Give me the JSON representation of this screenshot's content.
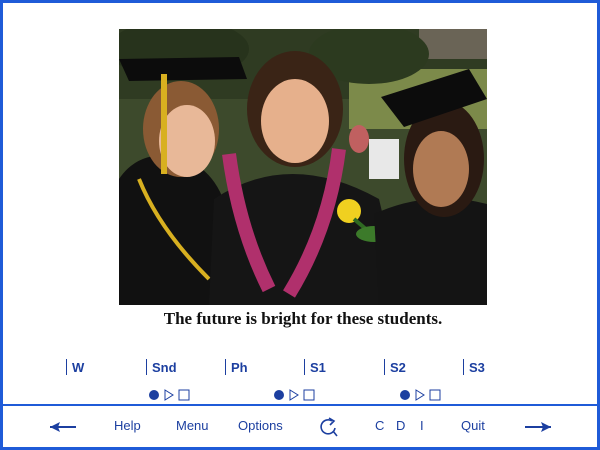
{
  "photo": {
    "alt": "Three graduates in caps and gowns with leis and a yellow rose"
  },
  "caption": "The future is bright for these students.",
  "tool_labels": [
    "W",
    "Snd",
    "Ph",
    "S1",
    "S2",
    "S3"
  ],
  "media_controls": [
    {
      "state": "record",
      "icons": [
        "circle-icon",
        "play-icon",
        "stop-icon"
      ]
    },
    {
      "state": "record",
      "icons": [
        "circle-icon",
        "play-icon",
        "stop-icon"
      ]
    },
    {
      "state": "record",
      "icons": [
        "circle-icon",
        "play-icon",
        "stop-icon"
      ]
    }
  ],
  "nav": {
    "help": "Help",
    "menu": "Menu",
    "options": "Options",
    "c": "C",
    "d": "D",
    "i": "I",
    "quit": "Quit"
  },
  "colors": {
    "border": "#1f5bd8",
    "text": "#1c3fa0"
  }
}
